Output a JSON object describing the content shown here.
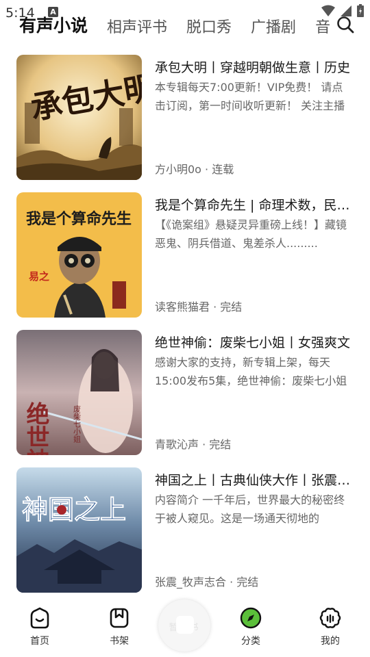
{
  "status_bar": {
    "time": "5:14",
    "notification": "A"
  },
  "tabs": [
    {
      "label": "有声小说",
      "active": true
    },
    {
      "label": "相声评书",
      "active": false
    },
    {
      "label": "脱口秀",
      "active": false
    },
    {
      "label": "广播剧",
      "active": false
    },
    {
      "label": "音",
      "active": false
    }
  ],
  "albums": [
    {
      "title": "承包大明丨穿越明朝做生意丨历史",
      "description": "本专辑每天7:00更新！VIP免费！ 请点击订阅，第一时间收听更新！ 关注主播",
      "meta": "方小明0o · 连载",
      "cover_text": "承包大明"
    },
    {
      "title": "我是个算命先生 | 命理术数，民间奇闻",
      "description": "【《诡案组》悬疑灵异重磅上线！】藏镜恶鬼、阴兵借道、鬼差杀人.........",
      "meta": "读客熊猫君 · 完结",
      "cover_text": "我是个算命先生",
      "cover_author": "易之"
    },
    {
      "title": "绝世神偷：废柴七小姐丨女强爽文",
      "description": "感谢大家的支持，新专辑上架，每天15:00发布5集，绝世神偷：废柴七小姐",
      "meta": "青歌沁声 · 完结",
      "cover_text": "绝世神偷",
      "cover_subtitle": "废柴七小姐"
    },
    {
      "title": "神国之上丨古典仙侠大作丨张震演播",
      "description": "内容简介 一千年后，世界最大的秘密终于被人窥见。这是一场通天彻地的",
      "meta": "张震_牧声志合 · 完结",
      "cover_text": "神国之上"
    }
  ],
  "bottom_nav": [
    {
      "label": "首页",
      "icon": "home-icon"
    },
    {
      "label": "书架",
      "icon": "bookshelf-icon"
    },
    {
      "label": "分类",
      "icon": "compass-icon",
      "active": true
    },
    {
      "label": "我的",
      "icon": "profile-icon"
    }
  ],
  "player": {
    "placeholder": "暂无书"
  },
  "colors": {
    "accent": "#5bbf3a",
    "text": "#1a1a1a",
    "secondary": "#666666"
  }
}
